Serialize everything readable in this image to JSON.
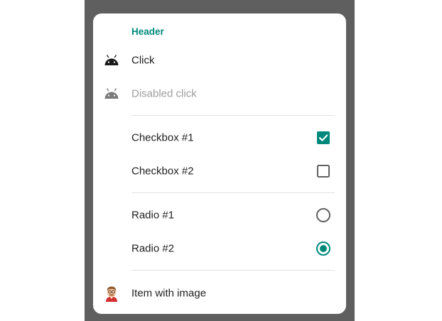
{
  "menu": {
    "header": "Header",
    "items": [
      {
        "label": "Click",
        "icon": "android-icon",
        "enabled": true
      },
      {
        "label": "Disabled click",
        "icon": "android-icon",
        "enabled": false
      }
    ],
    "checkboxes": [
      {
        "label": "Checkbox #1",
        "checked": true
      },
      {
        "label": "Checkbox #2",
        "checked": false
      }
    ],
    "radios": [
      {
        "label": "Radio #1",
        "selected": false
      },
      {
        "label": "Radio #2",
        "selected": true
      }
    ],
    "image_item": {
      "label": "Item with image",
      "icon": "avatar-icon"
    }
  },
  "colors": {
    "accent": "#00897b",
    "text": "#212121",
    "disabled_text": "#9e9e9e",
    "disabled_icon": "#7a7a7a",
    "scrim": "#5f5f5f"
  }
}
